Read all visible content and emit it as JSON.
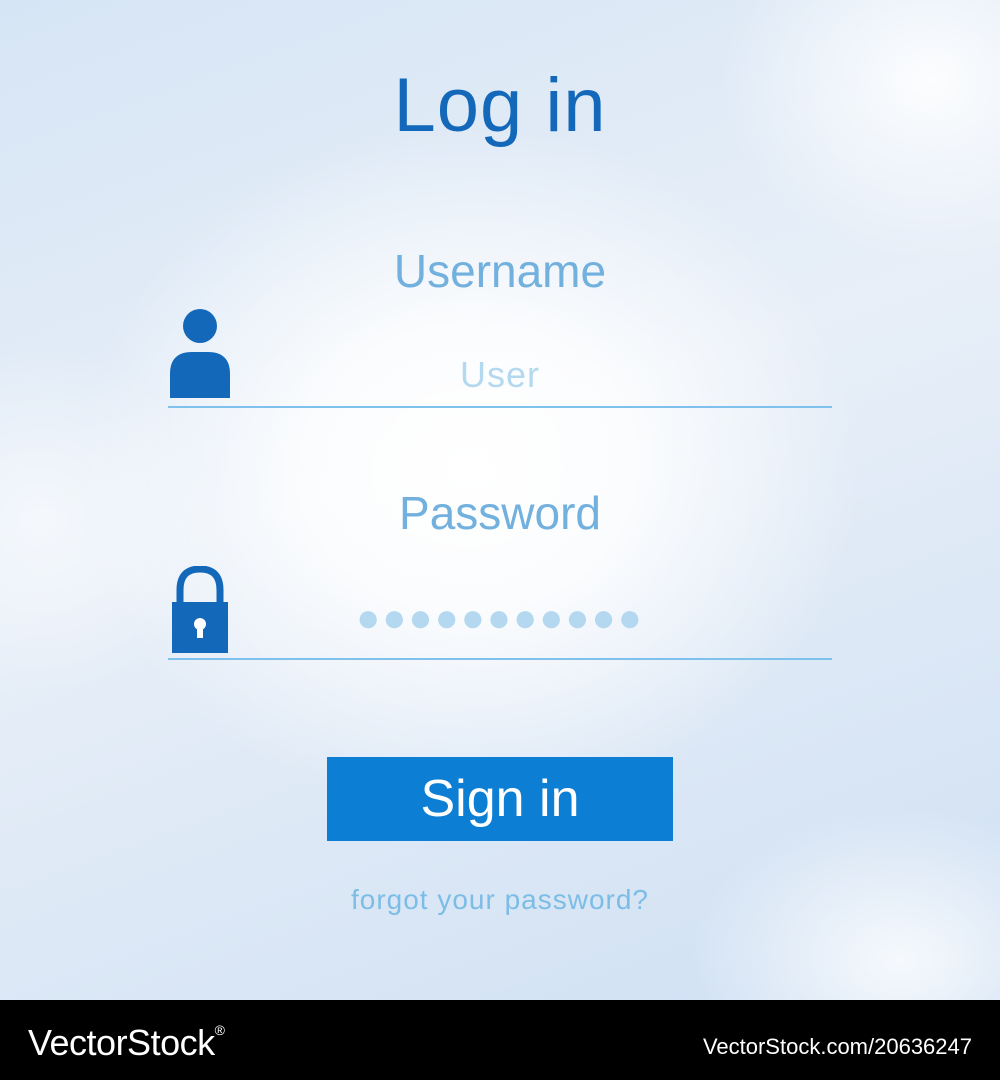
{
  "form": {
    "title": "Log in",
    "username": {
      "label": "Username",
      "value": "User"
    },
    "password": {
      "label": "Password",
      "value": "●●●●●●●●●●●"
    },
    "submit_label": "Sign in",
    "forgot_label": "forgot your password?"
  },
  "footer": {
    "brand": "VectorStock",
    "brand_mark": "®",
    "stock_id": "VectorStock.com/20636247"
  },
  "colors": {
    "title": "#1368b9",
    "label": "#72b0de",
    "accent_button": "#0c7fd4",
    "underline": "#7ec1ec",
    "icon": "#1368b9"
  },
  "icons": {
    "username": "user-icon",
    "password": "lock-icon"
  }
}
